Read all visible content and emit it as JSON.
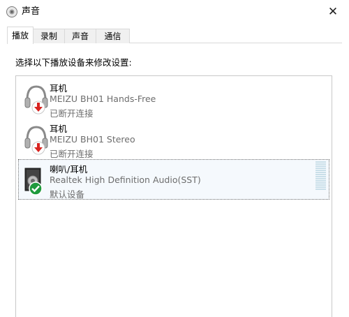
{
  "window": {
    "title": "声音",
    "close_glyph": "✕",
    "icon": "speaker-icon"
  },
  "tabs": [
    {
      "label": "播放",
      "active": true
    },
    {
      "label": "录制",
      "active": false
    },
    {
      "label": "声音",
      "active": false
    },
    {
      "label": "通信",
      "active": false
    }
  ],
  "instruction": "选择以下播放设备来修改设置:",
  "devices": [
    {
      "name": "耳机",
      "description": "MEIZU BH01 Hands-Free",
      "status": "已断开连接",
      "icon": "headphones-icon",
      "badge": "disconnected-arrow-icon",
      "selected": false
    },
    {
      "name": "耳机",
      "description": "MEIZU BH01 Stereo",
      "status": "已断开连接",
      "icon": "headphones-icon",
      "badge": "disconnected-arrow-icon",
      "selected": false
    },
    {
      "name": "喇叭/耳机",
      "description": "Realtek High Definition Audio(SST)",
      "status": "默认设备",
      "icon": "speaker-device-icon",
      "badge": "default-check-icon",
      "selected": true,
      "level": 0
    }
  ],
  "colors": {
    "disconnected_badge": "#d8231f",
    "default_badge": "#1e9a3c",
    "secondary_text": "#6d6d6d",
    "selection_background": "#f5f9fd"
  }
}
